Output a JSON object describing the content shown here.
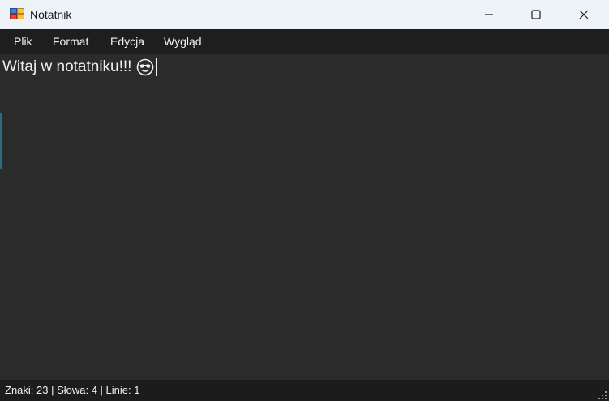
{
  "window": {
    "title": "Notatnik",
    "icon": "notepad-app-icon",
    "controls": {
      "minimize": "minimize-icon",
      "maximize": "maximize-icon",
      "close": "close-icon"
    }
  },
  "menu": {
    "items": [
      {
        "label": "Plik"
      },
      {
        "label": "Format"
      },
      {
        "label": "Edycja"
      },
      {
        "label": "Wygląd"
      }
    ]
  },
  "editor": {
    "text": "Witaj w notatniku!!!",
    "emoji": "smiling-face-with-sunglasses-icon"
  },
  "status": {
    "text": "Znaki: 23 | Słowa: 4 | Linie: 1"
  },
  "colors": {
    "titlebar_bg": "#eef3f9",
    "menubar_bg": "#1e1e1e",
    "editor_bg": "#2b2b2b",
    "statusbar_bg": "#1c1c1c",
    "text": "#f0f0f0"
  }
}
